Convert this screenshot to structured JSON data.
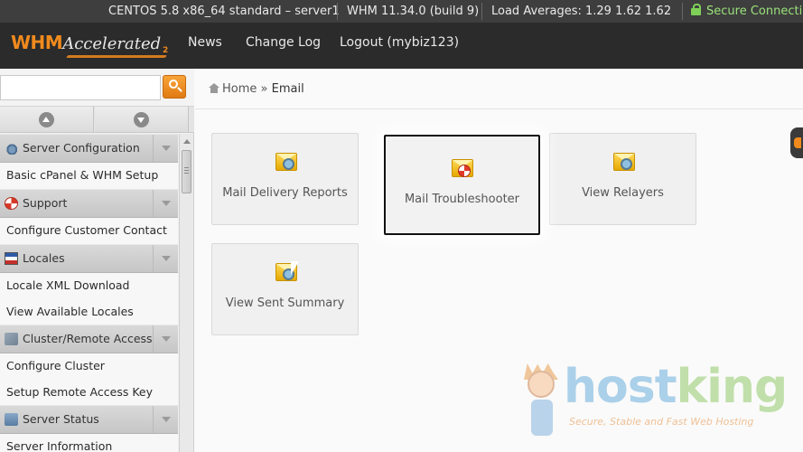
{
  "statusbar": {
    "server": "CENTOS 5.8 x86_64 standard – server1",
    "version": "WHM 11.34.0 (build 9)",
    "load": "Load Averages: 1.29 1.62 1.62",
    "secure": "Secure Connectio"
  },
  "header": {
    "logo_main": "WHM",
    "logo_accent": "Accelerated",
    "logo_num": "2",
    "nav": [
      "News",
      "Change Log",
      "Logout (mybiz123)"
    ]
  },
  "sidebar": {
    "search_value": "",
    "groups": [
      {
        "label": "Server Configuration",
        "icon": "gear-icon",
        "items": [
          "Basic cPanel & WHM Setup"
        ]
      },
      {
        "label": "Support",
        "icon": "lifebuoy-icon",
        "items": [
          "Configure Customer Contact"
        ]
      },
      {
        "label": "Locales",
        "icon": "flag-icon",
        "items": [
          "Locale XML Download",
          "View Available Locales"
        ]
      },
      {
        "label": "Cluster/Remote Access",
        "icon": "cluster-icon",
        "items": [
          "Configure Cluster",
          "Setup Remote Access Key"
        ]
      },
      {
        "label": "Server Status",
        "icon": "status-icon",
        "items": [
          "Server Information"
        ]
      }
    ]
  },
  "breadcrumb": {
    "home": "Home",
    "separator": "»",
    "current": "Email"
  },
  "tiles": [
    {
      "label": "Mail Delivery Reports",
      "icon": "mail-search-icon"
    },
    {
      "label": "Mail Troubleshooter",
      "icon": "mail-lifebuoy-icon"
    },
    {
      "label": "View Relayers",
      "icon": "mail-search-icon"
    },
    {
      "label": "View Sent Summary",
      "icon": "mail-search-icon"
    }
  ],
  "watermark": {
    "host": "host",
    "king": "king",
    "tagline": "Secure, Stable and Fast Web Hosting"
  },
  "colors": {
    "accent": "#f08a1d",
    "header_bg": "#2b2b2b",
    "secure": "#9be27a"
  }
}
